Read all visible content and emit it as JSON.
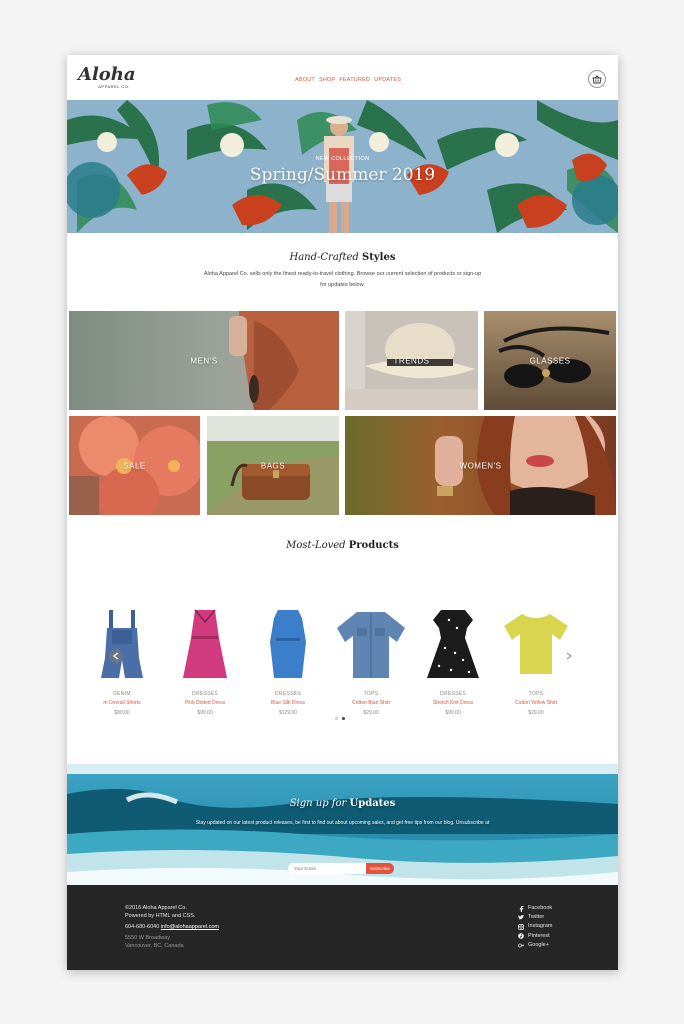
{
  "header": {
    "logo": "Aloha",
    "logo_sub": "APPAREL CO.",
    "nav": [
      "ABOUT",
      "SHOP",
      "FEATURED",
      "UPDATES"
    ]
  },
  "hero": {
    "kicker": "NEW COLLECTION",
    "title": "Spring/Summer 2019"
  },
  "intro": {
    "title_italic": "Hand-Crafted",
    "title_bold": "Styles",
    "text": "Aloha Apparel Co. sells only the finest ready-to-travel clothing. Browse our current selection of products or sign-up for updates below."
  },
  "categories": [
    "MEN'S",
    "TRENDS",
    "GLASSES",
    "SALE",
    "BAGS",
    "WOMEN'S"
  ],
  "products_section": {
    "title_italic": "Most-Loved",
    "title_bold": "Products"
  },
  "products": [
    {
      "category": "DENIM",
      "name": "m Overall Shorts",
      "price": "$80.00"
    },
    {
      "category": "DRESSES",
      "name": "Pink Dotted Dress",
      "price": "$99.00"
    },
    {
      "category": "DRESSES",
      "name": "Blue Silk Dress",
      "price": "$129.00"
    },
    {
      "category": "TOPS",
      "name": "Cotton Blue Shirt",
      "price": "$29.00"
    },
    {
      "category": "DRESSES",
      "name": "Stretch Knit Dress",
      "price": "$99.00"
    },
    {
      "category": "TOPS",
      "name": "Cotton Yellow Shirt",
      "price": "$29.00"
    }
  ],
  "signup": {
    "title_italic": "Sign up for",
    "title_bold": "Updates",
    "text": "Stay updated on our latest product releases, be first to find out about upcoming sales, and get free tips from our blog. Unsubscribe at",
    "email_placeholder": "Your Email",
    "button": "Subscribe"
  },
  "footer": {
    "copyright": "©2016 Aloha Apparel Co.",
    "powered": "Powered by HTML and CSS.",
    "phone": "604-680-6040",
    "email": "info@alohaapparel.com",
    "address1": "5550 W Broadway",
    "address2": "Vancouver, BC, Canada",
    "social": [
      "Facebook",
      "Twitter",
      "Instagram",
      "Pinterest",
      "Google+"
    ]
  },
  "colors": {
    "accent": "#e0533c",
    "footer_bg": "#262626"
  }
}
